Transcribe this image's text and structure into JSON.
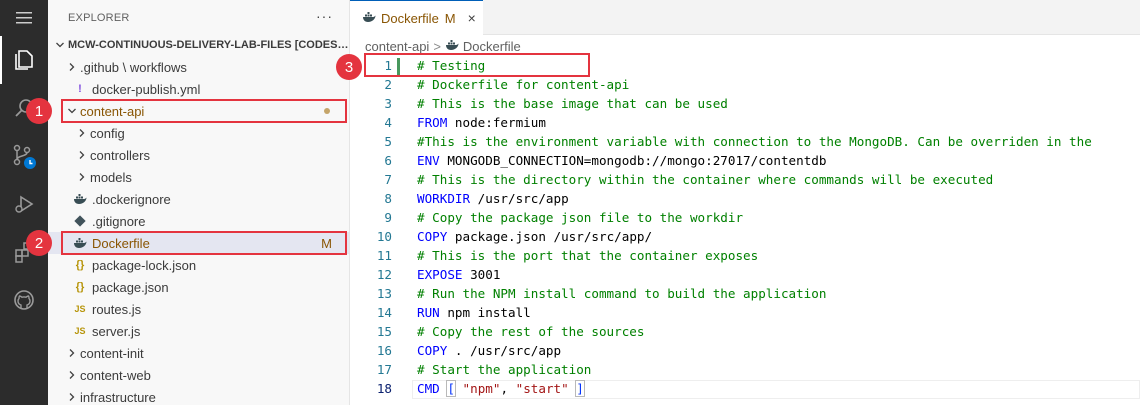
{
  "explorer": {
    "title": "EXPLORER",
    "more": "···",
    "root_label": "MCW-CONTINUOUS-DELIVERY-LAB-FILES [CODESP...",
    "items": [
      {
        "label": ".github \\ workflows"
      },
      {
        "label": "docker-publish.yml",
        "icon": "!"
      },
      {
        "label": "content-api"
      },
      {
        "label": "config"
      },
      {
        "label": "controllers"
      },
      {
        "label": "models"
      },
      {
        "label": ".dockerignore"
      },
      {
        "label": ".gitignore"
      },
      {
        "label": "Dockerfile",
        "badge": "M"
      },
      {
        "label": "package-lock.json",
        "icon": "{}"
      },
      {
        "label": "package.json",
        "icon": "{}"
      },
      {
        "label": "routes.js",
        "icon": "JS"
      },
      {
        "label": "server.js",
        "icon": "JS"
      },
      {
        "label": "content-init"
      },
      {
        "label": "content-web"
      },
      {
        "label": "infrastructure"
      }
    ]
  },
  "tab": {
    "label": "Dockerfile",
    "modified": "M",
    "close": "×"
  },
  "breadcrumb": {
    "folder": "content-api",
    "separator": ">",
    "file": "Dockerfile"
  },
  "code_lines": [
    {
      "n": "1",
      "text": "# Testing",
      "type": "comment"
    },
    {
      "n": "2",
      "text": "# Dockerfile for content-api",
      "type": "comment"
    },
    {
      "n": "3",
      "text": "# This is the base image that can be used",
      "type": "comment"
    },
    {
      "n": "4",
      "kw": "FROM",
      "rest": " node:fermium"
    },
    {
      "n": "5",
      "text": "#This is the environment variable with connection to the MongoDB. Can be overriden in the",
      "type": "comment"
    },
    {
      "n": "6",
      "kw": "ENV",
      "rest": " MONGODB_CONNECTION=mongodb://mongo:27017/contentdb"
    },
    {
      "n": "7",
      "text": "# This is the directory within the container where commands will be executed",
      "type": "comment"
    },
    {
      "n": "8",
      "kw": "WORKDIR",
      "rest": " /usr/src/app"
    },
    {
      "n": "9",
      "text": "# Copy the package json file to the workdir",
      "type": "comment"
    },
    {
      "n": "10",
      "kw": "COPY",
      "rest": " package.json /usr/src/app/"
    },
    {
      "n": "11",
      "text": "# This is the port that the container exposes",
      "type": "comment"
    },
    {
      "n": "12",
      "kw": "EXPOSE",
      "rest": " 3001"
    },
    {
      "n": "13",
      "text": "# Run the NPM install command to build the application",
      "type": "comment"
    },
    {
      "n": "14",
      "kw": "RUN",
      "rest": " npm install"
    },
    {
      "n": "15",
      "text": "# Copy the rest of the sources",
      "type": "comment"
    },
    {
      "n": "16",
      "kw": "COPY",
      "rest": " . /usr/src/app"
    },
    {
      "n": "17",
      "text": "# Start the application",
      "type": "comment"
    },
    {
      "n": "18",
      "kw": "CMD",
      "cmd": {
        "open": "[",
        "s1": "\"npm\"",
        "comma": ", ",
        "s2": "\"start\"",
        "close": "]"
      }
    }
  ],
  "callouts": [
    "1",
    "2",
    "3"
  ],
  "colors": {
    "accent": "#005fb8",
    "callout": "#e4343f",
    "modified": "#895503"
  }
}
